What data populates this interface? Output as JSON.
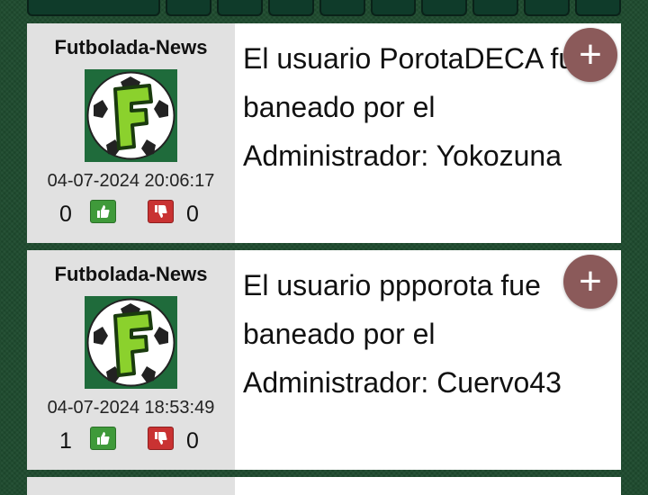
{
  "posts": [
    {
      "author": "Futbolada-News",
      "timestamp": "04-07-2024 20:06:17",
      "likes": "0",
      "dislikes": "0",
      "message": "El usuario PorotaDECA fue baneado por el Administrador: Yokozuna",
      "expand_label": "+"
    },
    {
      "author": "Futbolada-News",
      "timestamp": "04-07-2024 18:53:49",
      "likes": "1",
      "dislikes": "0",
      "message": "El usuario ppporota fue baneado por el Administrador: Cuervo43",
      "expand_label": "+"
    }
  ],
  "icons": {
    "like": "thumbs-up-icon",
    "dislike": "thumbs-down-icon",
    "expand": "plus-icon",
    "avatar": "futbolada-f-ball-logo"
  },
  "colors": {
    "background": "#1e4a2e",
    "like": "#3f9a3a",
    "dislike": "#c93232",
    "expand_button": "#8b5a5a"
  }
}
